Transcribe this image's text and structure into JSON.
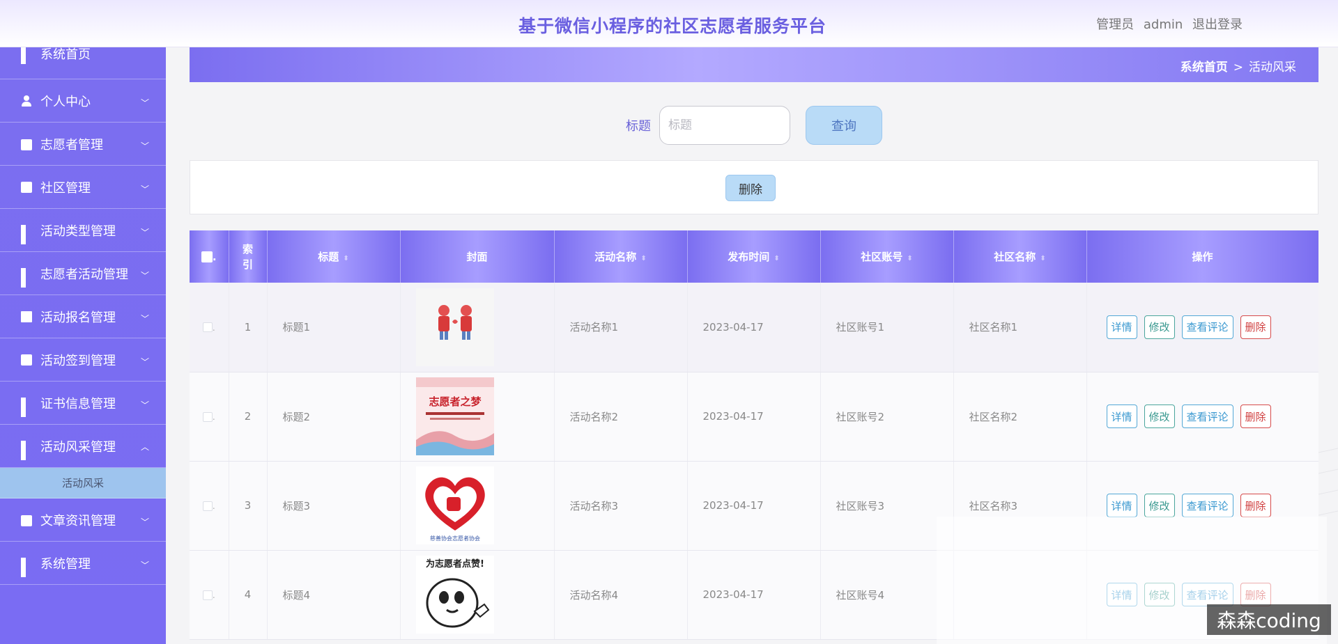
{
  "header": {
    "title": "基于微信小程序的社区志愿者服务平台",
    "role": "管理员",
    "username": "admin",
    "logout": "退出登录"
  },
  "sidebar": {
    "items": [
      {
        "label": "系统首页",
        "icon": "grid-icon"
      },
      {
        "label": "个人中心",
        "icon": "user-icon"
      },
      {
        "label": "志愿者管理",
        "icon": "briefcase-icon"
      },
      {
        "label": "社区管理",
        "icon": "chat-icon"
      },
      {
        "label": "活动类型管理",
        "icon": "grid-icon"
      },
      {
        "label": "志愿者活动管理",
        "icon": "grid-icon"
      },
      {
        "label": "活动报名管理",
        "icon": "book-icon"
      },
      {
        "label": "活动签到管理",
        "icon": "clipboard-icon"
      },
      {
        "label": "证书信息管理",
        "icon": "grid-icon"
      },
      {
        "label": "活动风采管理",
        "icon": "grid-icon"
      },
      {
        "label": "文章资讯管理",
        "icon": "ticket-icon"
      },
      {
        "label": "系统管理",
        "icon": "grid-icon"
      }
    ],
    "sub_item": "活动风采"
  },
  "breadcrumb": {
    "home": "系统首页",
    "separator": ">",
    "current": "活动风采"
  },
  "search": {
    "label": "标题",
    "placeholder": "标题",
    "button": "查询"
  },
  "actions": {
    "delete": "删除"
  },
  "table": {
    "columns": [
      "索引",
      "标题",
      "封面",
      "活动名称",
      "发布时间",
      "社区账号",
      "社区名称",
      "操作"
    ],
    "rows": [
      {
        "index": "1",
        "title": "标题1",
        "activity": "活动名称1",
        "date": "2023-04-17",
        "account": "社区账号1",
        "community": "社区名称1",
        "cover_text": ""
      },
      {
        "index": "2",
        "title": "标题2",
        "activity": "活动名称2",
        "date": "2023-04-17",
        "account": "社区账号2",
        "community": "社区名称2",
        "cover_text": "志愿者之梦"
      },
      {
        "index": "3",
        "title": "标题3",
        "activity": "活动名称3",
        "date": "2023-04-17",
        "account": "社区账号3",
        "community": "社区名称3",
        "cover_text": "慈善协会志愿者协会"
      },
      {
        "index": "4",
        "title": "标题4",
        "activity": "活动名称4",
        "date": "2023-04-17",
        "account": "社区账号4",
        "community": "",
        "cover_text": "为志愿者点赞!"
      }
    ],
    "ops": {
      "detail": "详情",
      "edit": "修改",
      "comments": "查看评论",
      "delete": "删除"
    }
  },
  "watermark": "森森coding",
  "colors": {
    "primary": "#7b6ef0",
    "title": "#6a5fe0",
    "sub_active": "#9ec4ee",
    "danger": "#d04040"
  }
}
